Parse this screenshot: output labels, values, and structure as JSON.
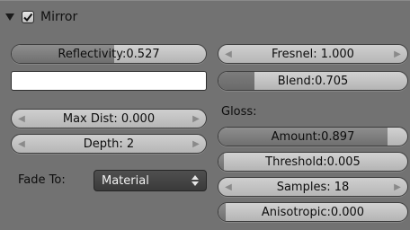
{
  "header": {
    "title": "Mirror",
    "checked": true
  },
  "left": {
    "reflectivity": {
      "label": "Reflectivity:0.527",
      "value": 0.527
    },
    "color_swatch": "#ffffff",
    "max_dist": {
      "label": "Max Dist: 0.000"
    },
    "depth": {
      "label": "Depth: 2"
    },
    "fade_to": {
      "label": "Fade To:",
      "value": "Material"
    }
  },
  "right": {
    "fresnel": {
      "label": "Fresnel: 1.000"
    },
    "blend": {
      "label": "Blend:0.705",
      "value": 0.705
    },
    "gloss_title": "Gloss:",
    "amount": {
      "label": "Amount:0.897",
      "value": 0.897
    },
    "threshold": {
      "label": "Threshold:0.005",
      "value": 0.005
    },
    "samples": {
      "label": "Samples: 18"
    },
    "anisotropic": {
      "label": "Anisotropic:0.000",
      "value": 0.0
    }
  },
  "colors": {
    "panel_bg": "#727272",
    "field_fill": "#7a7a7a",
    "field_bg": "#c4c4c4",
    "select_bg": "#444444"
  }
}
